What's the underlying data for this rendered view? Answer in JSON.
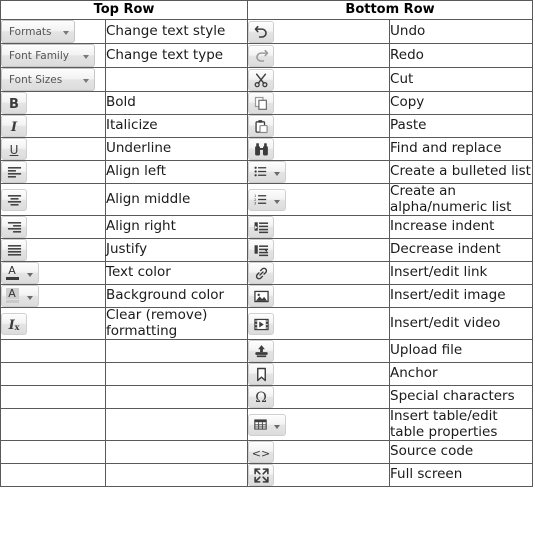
{
  "table": {
    "headers": [
      {
        "label": "Top Row",
        "span": 2
      },
      {
        "label": "Bottom Row",
        "span": 2
      }
    ],
    "header_bg": "#9dc3e6",
    "border_color": "#5a5a5a",
    "rows": [
      {
        "top_icon": {
          "type": "dropdown",
          "name": "formats-dropdown",
          "label": "Formats"
        },
        "top_label": "Change text style",
        "bottom_icon": {
          "type": "button",
          "name": "undo-icon",
          "glyph": "undo"
        },
        "bottom_label": "Undo"
      },
      {
        "top_icon": {
          "type": "dropdown",
          "name": "font-family-dropdown",
          "label": "Font Family"
        },
        "top_label": "Change text type",
        "bottom_icon": {
          "type": "button",
          "name": "redo-icon",
          "glyph": "redo"
        },
        "bottom_label": "Redo"
      },
      {
        "top_icon": {
          "type": "dropdown",
          "name": "font-sizes-dropdown",
          "label": "Font Sizes"
        },
        "top_label": "",
        "bottom_icon": {
          "type": "button",
          "name": "cut-scissors-icon",
          "glyph": "scissors"
        },
        "bottom_label": "Cut"
      },
      {
        "top_icon": {
          "type": "button",
          "name": "bold-icon",
          "glyph": "B"
        },
        "top_label": "Bold",
        "bottom_icon": {
          "type": "button",
          "name": "copy-icon",
          "glyph": "copy"
        },
        "bottom_label": "Copy"
      },
      {
        "top_icon": {
          "type": "button",
          "name": "italic-icon",
          "glyph": "I"
        },
        "top_label": "Italicize",
        "bottom_icon": {
          "type": "button",
          "name": "paste-clipboard-icon",
          "glyph": "paste"
        },
        "bottom_label": "Paste"
      },
      {
        "top_icon": {
          "type": "button",
          "name": "underline-icon",
          "glyph": "U"
        },
        "top_label": "Underline",
        "bottom_icon": {
          "type": "button",
          "name": "binoculars-find-replace-icon",
          "glyph": "binoculars"
        },
        "bottom_label": "Find and replace"
      },
      {
        "top_icon": {
          "type": "button",
          "name": "align-left-icon",
          "glyph": "align-left"
        },
        "top_label": "Align left",
        "bottom_icon": {
          "type": "split",
          "name": "bulleted-list-icon",
          "glyph": "bullet-list"
        },
        "bottom_label": "Create a bulleted list"
      },
      {
        "top_icon": {
          "type": "button",
          "name": "align-center-icon",
          "glyph": "align-center"
        },
        "top_label": "Align middle",
        "bottom_icon": {
          "type": "split",
          "name": "numbered-list-icon",
          "glyph": "number-list"
        },
        "bottom_label": "Create an alpha/numeric list"
      },
      {
        "top_icon": {
          "type": "button",
          "name": "align-right-icon",
          "glyph": "align-right"
        },
        "top_label": "Align right",
        "bottom_icon": {
          "type": "button",
          "name": "increase-indent-icon",
          "glyph": "indent"
        },
        "bottom_label": "Increase indent"
      },
      {
        "top_icon": {
          "type": "button",
          "name": "justify-icon",
          "glyph": "justify"
        },
        "top_label": "Justify",
        "bottom_icon": {
          "type": "button",
          "name": "decrease-indent-icon",
          "glyph": "outdent"
        },
        "bottom_label": "Decrease indent"
      },
      {
        "top_icon": {
          "type": "split",
          "name": "text-color-icon",
          "glyph": "A-underline"
        },
        "top_label": "Text color",
        "bottom_icon": {
          "type": "button",
          "name": "link-icon",
          "glyph": "chain"
        },
        "bottom_label": "Insert/edit link"
      },
      {
        "top_icon": {
          "type": "split",
          "name": "background-color-icon",
          "glyph": "A-highlight"
        },
        "top_label": "Background color",
        "bottom_icon": {
          "type": "button",
          "name": "image-icon",
          "glyph": "picture"
        },
        "bottom_label": "Insert/edit image"
      },
      {
        "top_icon": {
          "type": "button",
          "name": "clear-formatting-icon",
          "glyph": "Ix"
        },
        "top_label": "Clear (remove) formatting",
        "bottom_icon": {
          "type": "button",
          "name": "video-icon",
          "glyph": "filmstrip"
        },
        "bottom_label": "Insert/edit video"
      },
      {
        "top_icon": null,
        "top_label": "",
        "bottom_icon": {
          "type": "button",
          "name": "upload-file-icon",
          "glyph": "upload"
        },
        "bottom_label": "Upload file"
      },
      {
        "top_icon": null,
        "top_label": "",
        "bottom_icon": {
          "type": "button",
          "name": "anchor-bookmark-icon",
          "glyph": "bookmark"
        },
        "bottom_label": "Anchor"
      },
      {
        "top_icon": null,
        "top_label": "",
        "bottom_icon": {
          "type": "button",
          "name": "special-characters-icon",
          "glyph": "omega"
        },
        "bottom_label": "Special characters"
      },
      {
        "top_icon": null,
        "top_label": "",
        "bottom_icon": {
          "type": "split",
          "name": "insert-table-icon",
          "glyph": "grid"
        },
        "bottom_label": "Insert table/edit table properties"
      },
      {
        "top_icon": null,
        "top_label": "",
        "bottom_icon": {
          "type": "button",
          "name": "source-code-icon",
          "glyph": "angle-brackets"
        },
        "bottom_label": "Source code"
      },
      {
        "top_icon": null,
        "top_label": "",
        "bottom_icon": {
          "type": "button",
          "name": "full-screen-icon",
          "glyph": "arrows-expand"
        },
        "bottom_label": "Full screen"
      }
    ]
  }
}
